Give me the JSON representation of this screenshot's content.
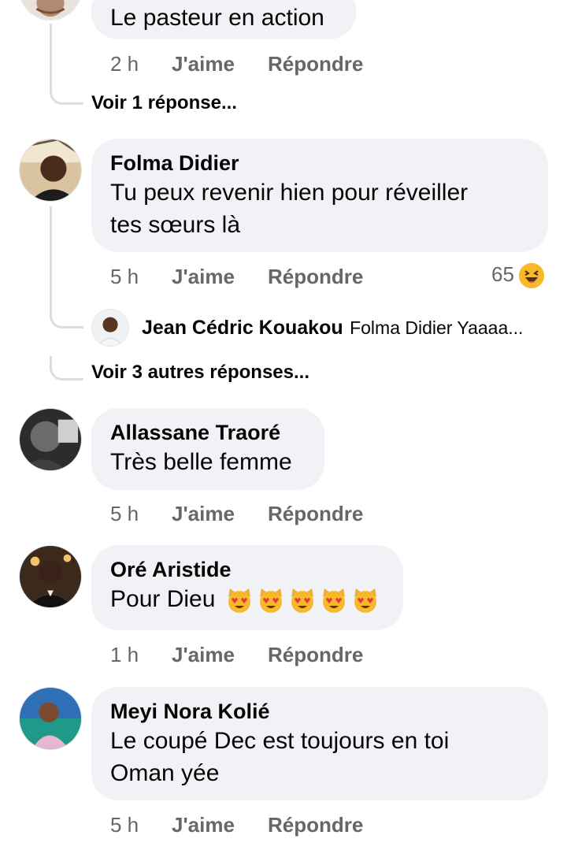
{
  "comments": [
    {
      "text": "Le pasteur en action",
      "time": "2 h",
      "like": "J'aime",
      "reply": "Répondre",
      "view_replies": "Voir 1 réponse..."
    },
    {
      "author": "Folma Didier",
      "text_line1": "Tu peux revenir hien pour réveiller",
      "text_line2": "tes sœurs là",
      "time": "5 h",
      "like": "J'aime",
      "reply": "Répondre",
      "reaction_count": "65",
      "reaction_icon": "laughing-face-icon",
      "reply_preview": {
        "author": "Jean Cédric Kouakou",
        "text": "Folma Didier Yaaaa..."
      },
      "view_replies": "Voir 3 autres réponses..."
    },
    {
      "author": "Allassane Traoré",
      "text": "Très belle femme",
      "time": "5 h",
      "like": "J'aime",
      "reply": "Répondre"
    },
    {
      "author": "Oré Aristide",
      "text": "Pour Dieu",
      "emoji": [
        "heart-eyes-cat-icon",
        "heart-eyes-cat-icon",
        "heart-eyes-cat-icon",
        "heart-eyes-cat-icon",
        "heart-eyes-cat-icon"
      ],
      "time": "1 h",
      "like": "J'aime",
      "reply": "Répondre"
    },
    {
      "author": "Meyi Nora Kolié",
      "text_line1": "Le coupé Dec est toujours en toi",
      "text_line2": "Oman yée",
      "time": "5 h",
      "like": "J'aime",
      "reply": "Répondre"
    }
  ],
  "colors": {
    "bubble": "#f0f2f5",
    "meta": "#65676b",
    "text": "#050505",
    "thread": "#dadde1",
    "emoji": "#f7b928"
  }
}
